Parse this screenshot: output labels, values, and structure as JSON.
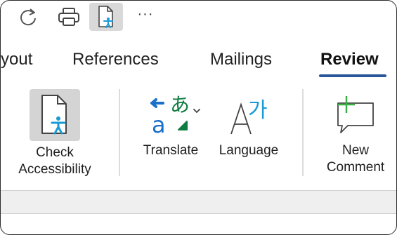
{
  "quick_access": {
    "redo_icon": "redo-icon",
    "print_icon": "print-icon",
    "accessibility_icon": "check-accessibility-icon",
    "more_label": "···"
  },
  "tabs": [
    {
      "label": "yout"
    },
    {
      "label": "References"
    },
    {
      "label": "Mailings"
    },
    {
      "label": "Review",
      "active": true
    }
  ],
  "ribbon": {
    "check_accessibility": {
      "line1": "Check",
      "line2": "Accessibility"
    },
    "translate": {
      "label": "Translate"
    },
    "language": {
      "label": "Language"
    },
    "new_comment": {
      "line1": "New",
      "line2": "Comment"
    }
  },
  "colors": {
    "accent": "#2b579a",
    "accessibility_blue": "#1a9ad6",
    "translate_blue": "#1a6fc9",
    "translate_green": "#107c41",
    "comment_green": "#3cb043"
  }
}
